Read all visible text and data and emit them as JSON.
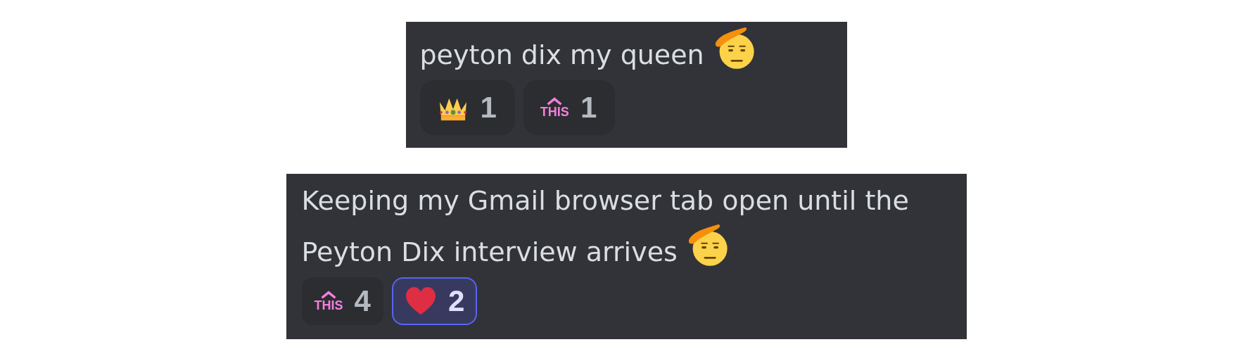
{
  "messages": [
    {
      "text": "peyton dix my queen",
      "reactions": [
        {
          "kind": "crown",
          "count": "1",
          "selected": false
        },
        {
          "kind": "this",
          "emoji_text": "THIS",
          "count": "1",
          "selected": false
        }
      ]
    },
    {
      "text": "Keeping my Gmail browser tab open until the Peyton Dix interview arrives",
      "reactions": [
        {
          "kind": "this",
          "emoji_text": "THIS",
          "count": "4",
          "selected": false
        },
        {
          "kind": "heart",
          "count": "2",
          "selected": true
        }
      ]
    }
  ]
}
